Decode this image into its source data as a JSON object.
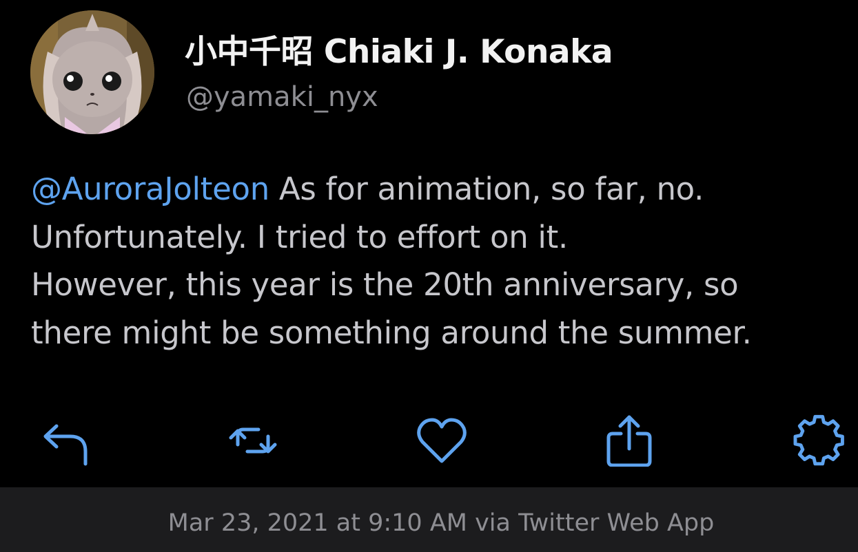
{
  "user": {
    "display_name": "小中千昭 Chiaki J. Konaka",
    "handle": "@yamaki_nyx"
  },
  "tweet": {
    "mention": "@AuroraJolteon",
    "text": " As for animation, so far, no.\nUnfortunately. I tried to effort on it.\nHowever, this year is the 20th anniversary, so\nthere might be something around the summer."
  },
  "actions": [
    {
      "name": "reply",
      "icon": "reply-icon"
    },
    {
      "name": "retweet",
      "icon": "retweet-icon"
    },
    {
      "name": "like",
      "icon": "heart-icon"
    },
    {
      "name": "share",
      "icon": "share-icon"
    },
    {
      "name": "settings",
      "icon": "gear-icon"
    }
  ],
  "footer": {
    "timestamp": "Mar 23, 2021 at 9:10 AM via Twitter Web App"
  },
  "colors": {
    "background": "#000000",
    "accent": "#5ea3ef",
    "text": "#c7c7cc",
    "name": "#f2f2f2",
    "muted": "#8e8e93",
    "footer_bg": "#1c1c1e"
  }
}
